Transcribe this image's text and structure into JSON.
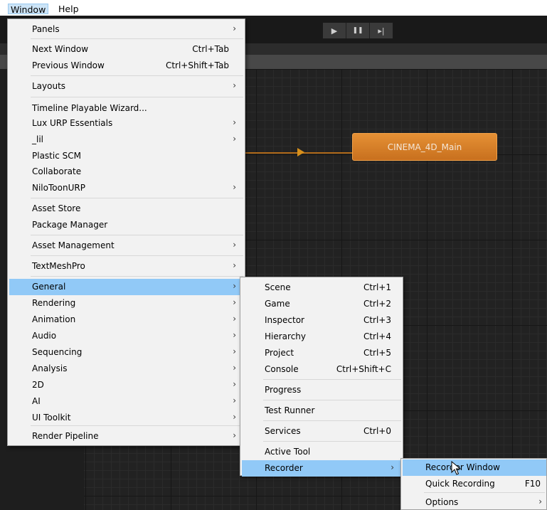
{
  "menubar": {
    "window_label": "Window",
    "help_label": "Help"
  },
  "toolbar": {
    "play_icon": "▶",
    "pause_icon": "❚❚",
    "step_icon": "▸|"
  },
  "graph": {
    "node_label": "CINEMA_4D_Main",
    "node_color": "#d9822b"
  },
  "window_menu": {
    "items": [
      {
        "label": "Panels",
        "shortcut": "",
        "submenu": true
      },
      {
        "label": "Next Window",
        "shortcut": "Ctrl+Tab",
        "submenu": false
      },
      {
        "label": "Previous Window",
        "shortcut": "Ctrl+Shift+Tab",
        "submenu": false
      },
      {
        "label": "Layouts",
        "shortcut": "",
        "submenu": true
      },
      {
        "label": "Timeline Playable Wizard...",
        "shortcut": "",
        "submenu": false
      },
      {
        "label": "Lux URP Essentials",
        "shortcut": "",
        "submenu": true
      },
      {
        "label": "_lil",
        "shortcut": "",
        "submenu": true
      },
      {
        "label": "Plastic SCM",
        "shortcut": "",
        "submenu": false
      },
      {
        "label": "Collaborate",
        "shortcut": "",
        "submenu": false
      },
      {
        "label": "NiloToonURP",
        "shortcut": "",
        "submenu": true
      },
      {
        "label": "Asset Store",
        "shortcut": "",
        "submenu": false
      },
      {
        "label": "Package Manager",
        "shortcut": "",
        "submenu": false
      },
      {
        "label": "Asset Management",
        "shortcut": "",
        "submenu": true
      },
      {
        "label": "TextMeshPro",
        "shortcut": "",
        "submenu": true
      },
      {
        "label": "General",
        "shortcut": "",
        "submenu": true,
        "highlighted": true
      },
      {
        "label": "Rendering",
        "shortcut": "",
        "submenu": true
      },
      {
        "label": "Animation",
        "shortcut": "",
        "submenu": true
      },
      {
        "label": "Audio",
        "shortcut": "",
        "submenu": true
      },
      {
        "label": "Sequencing",
        "shortcut": "",
        "submenu": true
      },
      {
        "label": "Analysis",
        "shortcut": "",
        "submenu": true
      },
      {
        "label": "2D",
        "shortcut": "",
        "submenu": true
      },
      {
        "label": "AI",
        "shortcut": "",
        "submenu": true
      },
      {
        "label": "UI Toolkit",
        "shortcut": "",
        "submenu": true
      },
      {
        "label": "Render Pipeline",
        "shortcut": "",
        "submenu": true
      }
    ]
  },
  "general_menu": {
    "items": [
      {
        "label": "Scene",
        "shortcut": "Ctrl+1",
        "submenu": false
      },
      {
        "label": "Game",
        "shortcut": "Ctrl+2",
        "submenu": false
      },
      {
        "label": "Inspector",
        "shortcut": "Ctrl+3",
        "submenu": false
      },
      {
        "label": "Hierarchy",
        "shortcut": "Ctrl+4",
        "submenu": false
      },
      {
        "label": "Project",
        "shortcut": "Ctrl+5",
        "submenu": false
      },
      {
        "label": "Console",
        "shortcut": "Ctrl+Shift+C",
        "submenu": false
      },
      {
        "label": "Progress",
        "shortcut": "",
        "submenu": false
      },
      {
        "label": "Test Runner",
        "shortcut": "",
        "submenu": false
      },
      {
        "label": "Services",
        "shortcut": "Ctrl+0",
        "submenu": false
      },
      {
        "label": "Active Tool",
        "shortcut": "",
        "submenu": false
      },
      {
        "label": "Recorder",
        "shortcut": "",
        "submenu": true,
        "highlighted": true
      }
    ]
  },
  "recorder_menu": {
    "items": [
      {
        "label": "Recorder Window",
        "shortcut": "",
        "submenu": false,
        "highlighted": true
      },
      {
        "label": "Quick Recording",
        "shortcut": "F10",
        "submenu": false
      },
      {
        "label": "Options",
        "shortcut": "",
        "submenu": true
      }
    ]
  },
  "colors": {
    "menu_highlight": "#91c9f7",
    "menu_bg": "#f2f2f2",
    "editor_bg": "#222222"
  }
}
